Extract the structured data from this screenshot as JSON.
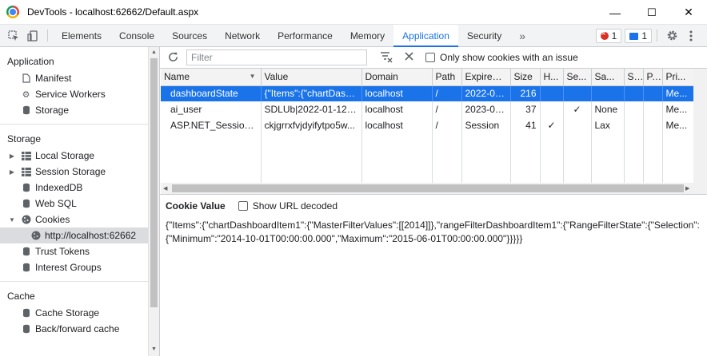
{
  "window": {
    "title": "DevTools - localhost:62662/Default.aspx",
    "minimize": "—",
    "maximize": "☐",
    "close": "✕"
  },
  "toolbar": {
    "tabs": [
      {
        "label": "Elements"
      },
      {
        "label": "Console"
      },
      {
        "label": "Sources"
      },
      {
        "label": "Network"
      },
      {
        "label": "Performance"
      },
      {
        "label": "Memory"
      },
      {
        "label": "Application",
        "active": true
      },
      {
        "label": "Security"
      }
    ],
    "more": "»",
    "errors_count": "1",
    "messages_count": "1"
  },
  "sidebar": {
    "application_header": "Application",
    "application_items": [
      {
        "label": "Manifest",
        "icon": "document-icon"
      },
      {
        "label": "Service Workers",
        "icon": "gear-icon"
      },
      {
        "label": "Storage",
        "icon": "database-icon"
      }
    ],
    "storage_header": "Storage",
    "storage_items": [
      {
        "label": "Local Storage",
        "icon": "grid-icon",
        "expandable": true
      },
      {
        "label": "Session Storage",
        "icon": "grid-icon",
        "expandable": true
      },
      {
        "label": "IndexedDB",
        "icon": "database-icon"
      },
      {
        "label": "Web SQL",
        "icon": "database-icon"
      },
      {
        "label": "Cookies",
        "icon": "cookie-icon",
        "expanded": true
      }
    ],
    "cookies_child": "http://localhost:62662",
    "storage_items_after": [
      {
        "label": "Trust Tokens",
        "icon": "database-icon"
      },
      {
        "label": "Interest Groups",
        "icon": "database-icon"
      }
    ],
    "cache_header": "Cache",
    "cache_items": [
      {
        "label": "Cache Storage",
        "icon": "database-icon"
      },
      {
        "label": "Back/forward cache",
        "icon": "database-icon"
      }
    ]
  },
  "filterbar": {
    "placeholder": "Filter",
    "only_issues_label": "Only show cookies with an issue"
  },
  "cookies_table": {
    "columns": [
      "Name",
      "Value",
      "Domain",
      "Path",
      "Expires ...",
      "Size",
      "H...",
      "Se...",
      "Sa...",
      "S...",
      "P...",
      "Pri..."
    ],
    "rows": [
      [
        "dashboardState",
        "{\"Items\":{\"chartDashboardItem1\"",
        "localhost",
        "/",
        "2022-07...",
        "216",
        "",
        "",
        "",
        "",
        "",
        "Me..."
      ],
      [
        "ai_user",
        "SDLUb|2022-01-12T...",
        "localhost",
        "/",
        "2023-01...",
        "37",
        "",
        "✓",
        "None",
        "",
        "",
        "Me..."
      ],
      [
        "ASP.NET_SessionId",
        "ckjgrrxfvjdyifytpo5w...",
        "localhost",
        "/",
        "Session",
        "41",
        "✓",
        "",
        "Lax",
        "",
        "",
        "Me..."
      ]
    ],
    "selected_row": 0
  },
  "cookie_value": {
    "title": "Cookie Value",
    "show_url_decoded": "Show URL decoded",
    "text": "{\"Items\":{\"chartDashboardItem1\":{\"MasterFilterValues\":[[2014]]},\"rangeFilterDashboardItem1\":{\"RangeFilterState\":{\"Selection\":{\"Minimum\":\"2014-10-01T00:00:00.000\",\"Maximum\":\"2015-06-01T00:00:00.000\"}}}}}"
  },
  "colors": {
    "accent": "#1a73e8",
    "selected_row": "#1a73e8",
    "error": "#d93025"
  }
}
